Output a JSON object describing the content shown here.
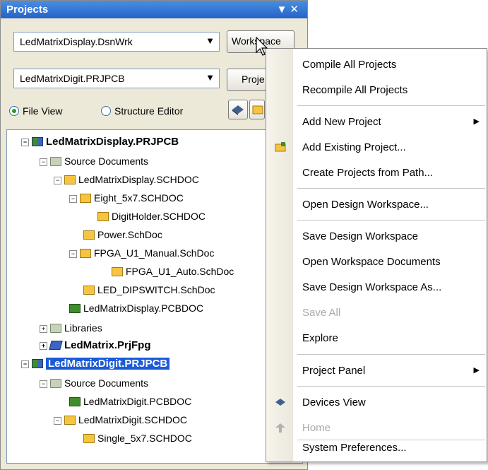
{
  "panel": {
    "title": "Projects",
    "workspace_combo": "LedMatrixDisplay.DsnWrk",
    "project_combo": "LedMatrixDigit.PRJPCB",
    "workspace_button": "Workspace",
    "project_button": "Proje",
    "radio_file_view": "File View",
    "radio_structure_editor": "Structure Editor"
  },
  "tree": [
    {
      "label": "LedMatrixDisplay.PRJPCB",
      "icon": "project-pcb-icon"
    },
    {
      "label": "Source Documents",
      "icon": "folder-icon"
    },
    {
      "label": "LedMatrixDisplay.SCHDOC",
      "icon": "schematic-icon"
    },
    {
      "label": "Eight_5x7.SCHDOC",
      "icon": "schematic-icon"
    },
    {
      "label": "DigitHolder.SCHDOC",
      "icon": "schematic-icon"
    },
    {
      "label": "Power.SchDoc",
      "icon": "schematic-icon"
    },
    {
      "label": "FPGA_U1_Manual.SchDoc",
      "icon": "schematic-icon"
    },
    {
      "label": "FPGA_U1_Auto.SchDoc",
      "icon": "schematic-icon"
    },
    {
      "label": "LED_DIPSWITCH.SchDoc",
      "icon": "schematic-icon"
    },
    {
      "label": "LedMatrixDisplay.PCBDOC",
      "icon": "pcb-icon"
    },
    {
      "label": "Libraries",
      "icon": "folder-icon"
    },
    {
      "label": "LedMatrix.PrjFpg",
      "icon": "fpga-project-icon"
    },
    {
      "label": "LedMatrixDigit.PRJPCB",
      "icon": "project-pcb-icon"
    },
    {
      "label": "Source Documents",
      "icon": "folder-icon"
    },
    {
      "label": "LedMatrixDigit.PCBDOC",
      "icon": "pcb-icon"
    },
    {
      "label": "LedMatrixDigit.SCHDOC",
      "icon": "schematic-icon"
    },
    {
      "label": "Single_5x7.SCHDOC",
      "icon": "schematic-icon"
    }
  ],
  "menu": {
    "items": [
      {
        "label": "Compile All Projects"
      },
      {
        "label": "Recompile All Projects"
      },
      {
        "label": "Add New Project"
      },
      {
        "label": "Add Existing Project..."
      },
      {
        "label": "Create Projects from Path..."
      },
      {
        "label": "Open Design Workspace..."
      },
      {
        "label": "Save Design Workspace"
      },
      {
        "label": "Open Workspace Documents"
      },
      {
        "label": "Save Design Workspace As..."
      },
      {
        "label": "Save All"
      },
      {
        "label": "Explore"
      },
      {
        "label": "Project Panel"
      },
      {
        "label": "Devices View"
      },
      {
        "label": "Home"
      },
      {
        "label": "System Preferences..."
      }
    ]
  },
  "colors": {
    "selection": "#1c5bd8",
    "titlebar": "#2463c8",
    "disabled_text": "#a8a8a8"
  }
}
